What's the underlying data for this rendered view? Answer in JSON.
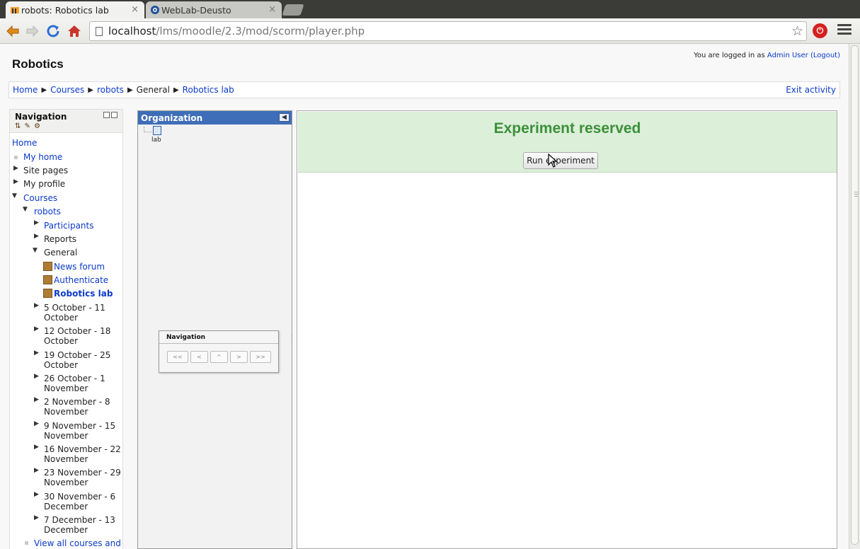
{
  "browser": {
    "tabs": [
      {
        "title": "robots: Robotics lab",
        "close": "×"
      },
      {
        "title": "WebLab-Deusto",
        "close": "×"
      }
    ],
    "url_host": "localhost",
    "url_path": "/lms/moodle/2.3/mod/scorm/player.php"
  },
  "header": {
    "site_title": "Robotics",
    "login_prefix": "You are logged in as ",
    "login_user": "Admin User",
    "logout": "(Logout)"
  },
  "breadcrumb": {
    "items": [
      "Home",
      "Courses",
      "robots",
      "General",
      "Robotics lab"
    ],
    "exit": "Exit activity"
  },
  "nav_block": {
    "title": "Navigation",
    "items": [
      "Home",
      "My home",
      "Site pages",
      "My profile",
      "Courses",
      "robots",
      "Participants",
      "Reports",
      "General",
      "News forum",
      "Authenticate",
      "Robotics lab",
      "5 October - 11",
      "October",
      "12 October - 18",
      "October",
      "19 October - 25",
      "October",
      "26 October - 1",
      "November",
      "2 November - 8",
      "November",
      "9 November - 15",
      "November",
      "16 November - 22",
      "November",
      "23 November - 29",
      "November",
      "30 November - 6",
      "December",
      "7 December - 13",
      "December",
      "View all courses and"
    ]
  },
  "organization": {
    "title": "Organization",
    "sco_label": "lab"
  },
  "scorm_nav": {
    "title": "Navigation",
    "buttons": [
      "<<",
      "<",
      "^",
      ">",
      ">>"
    ]
  },
  "content": {
    "message": "Experiment reserved",
    "run_button": "Run experiment",
    "accent_color": "#3c9039",
    "banner_color": "#dcefd9"
  }
}
